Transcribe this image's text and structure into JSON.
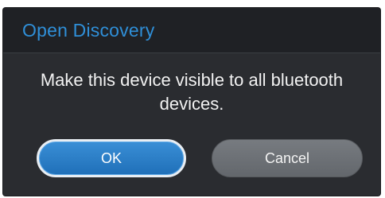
{
  "dialog": {
    "title": "Open Discovery",
    "message": "Make this device visible to all bluetooth devices.",
    "buttons": {
      "ok_label": "OK",
      "cancel_label": "Cancel"
    }
  },
  "colors": {
    "title_accent": "#2f8fd8",
    "dialog_background": "#2a2c30",
    "ok_button": "#2b7fc9",
    "cancel_button": "#6d7176"
  }
}
